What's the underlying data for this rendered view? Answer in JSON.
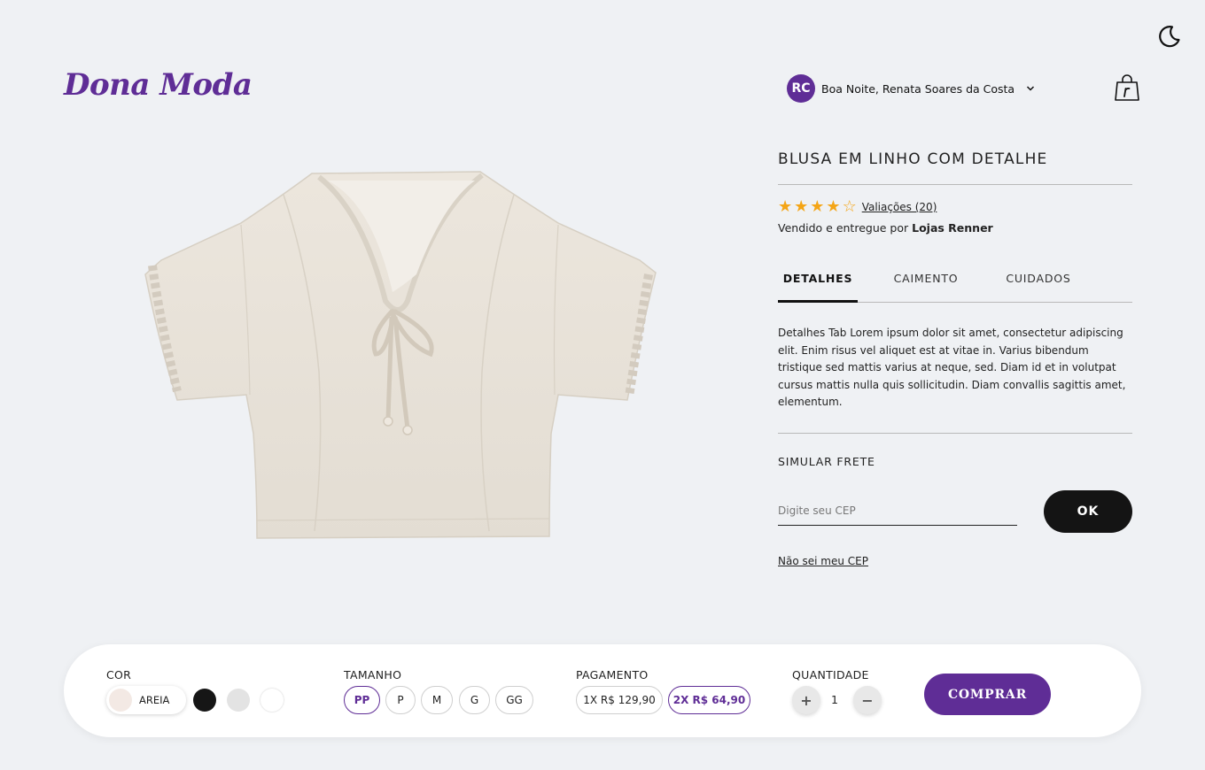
{
  "brand": {
    "logo_text": "Dona Moda",
    "accent_color": "#5f2d96"
  },
  "header": {
    "avatar_initials": "RC",
    "greeting": "Boa Noite, Renata Soares da Costa",
    "theme_icon": "moon-icon",
    "cart_icon": "shopping-bag-icon"
  },
  "product": {
    "title": "BLUSA EM LINHO COM DETALHE",
    "rating": 4,
    "rating_max": 5,
    "reviews_label": "Valiações (20)",
    "seller_prefix": "Vendido e entregue por ",
    "seller_name": "Lojas Renner",
    "image_icon": "linen-blouse-image"
  },
  "tabs": [
    {
      "label": "DETALHES",
      "active": true
    },
    {
      "label": "CAIMENTO",
      "active": false
    },
    {
      "label": "CUIDADOS",
      "active": false
    }
  ],
  "tab_content": "Detalhes Tab Lorem ipsum dolor sit amet, consectetur adipiscing elit. Enim risus vel aliquet est at vitae in. Varius bibendum tristique sed mattis varius at neque, sed. Diam id et in volutpat cursus mattis nulla quis sollicitudin. Diam convallis sagittis amet, elementum.",
  "shipping": {
    "label": "SIMULAR FRETE",
    "cep_placeholder": "Digite seu CEP",
    "cep_value": "",
    "ok_label": "OK",
    "no_cep_label": "Não sei meu CEP"
  },
  "purchase": {
    "color_label": "COR",
    "colors": [
      {
        "name": "AREIA",
        "hex": "#f3e9e4",
        "selected": true
      },
      {
        "name": "black",
        "hex": "#161616",
        "selected": false
      },
      {
        "name": "light-gray",
        "hex": "#e3e3e3",
        "selected": false
      },
      {
        "name": "white",
        "hex": "#ffffff",
        "selected": false
      }
    ],
    "size_label": "TAMANHO",
    "sizes": [
      "PP",
      "P",
      "M",
      "G",
      "GG"
    ],
    "selected_size": "PP",
    "payment_label": "PAGAMENTO",
    "payments": [
      "1X R$ 129,90",
      "2X R$ 64,90"
    ],
    "selected_payment": "2X R$ 64,90",
    "quantity_label": "QUANTIDADE",
    "quantity": "1",
    "plus_symbol": "+",
    "minus_symbol": "−",
    "buy_label": "COMPRAR"
  }
}
